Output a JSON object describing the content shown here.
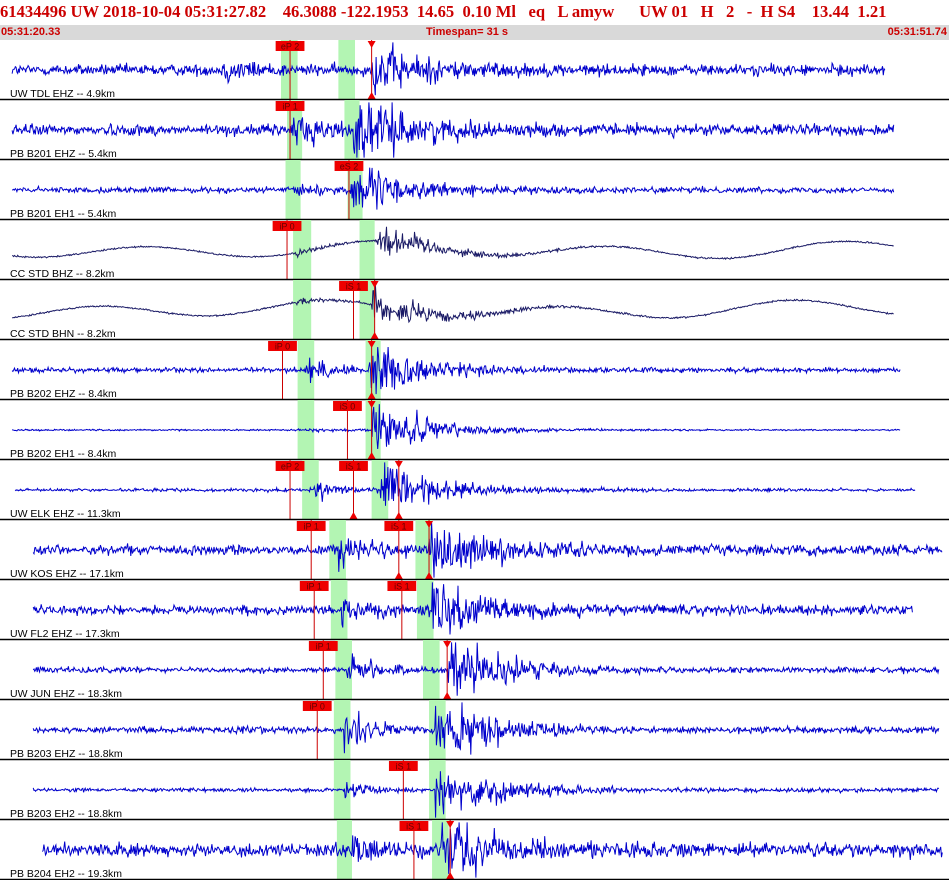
{
  "header": {
    "event_id": "61434496",
    "network": "UW",
    "origin_time": "2018-10-04 05:31:27.82",
    "lat": "46.3088",
    "lon": "-122.1953",
    "depth": "14.65",
    "depth_err": "0.10",
    "mag_type": "Ml",
    "event_type": "eq",
    "location_type": "L",
    "analyst": "amyw",
    "source": "UW",
    "version": "01",
    "flag1": "H",
    "flag2": "2",
    "flag3": "-",
    "flag4": "H",
    "flag5": "S4",
    "rms_value": "13.44",
    "magnitude": "1.21"
  },
  "timebar": {
    "start": "05:31:20.33",
    "span": "Timespan=  31 s",
    "end": "05:31:51.74"
  },
  "colors": {
    "header_text": "#cc0000",
    "timebar_bg": "#d9d9d9",
    "trace_short_period": "#0000cc",
    "trace_broadband": "#1a1a66",
    "pick_flag": "#ee0000",
    "pick_line": "#cc0000",
    "window_highlight": "#b3f5b3",
    "separator": "#000000",
    "label_text": "#000000"
  },
  "chart_data": {
    "type": "line",
    "title": "",
    "x_unit": "s",
    "xlim": [
      0,
      31.41
    ],
    "traces": [
      {
        "label": "UW TDL EHZ -- 4.9km",
        "network": "UW",
        "station": "TDL",
        "channel": "EHZ",
        "distance_km": 4.9,
        "kind": "sp",
        "data_start": 0.4,
        "data_end": 29.3,
        "p_onset": 7.4,
        "s_onset": 12.3,
        "noise": 0.14,
        "p_amp": 0.25,
        "s_amp": 0.6,
        "picks": [
          {
            "label": "eP 2",
            "time": 9.6,
            "marker": false
          },
          {
            "label": "",
            "time": 12.3,
            "marker": true
          }
        ],
        "windows": [
          {
            "start": 9.3,
            "end": 9.85
          },
          {
            "start": 11.2,
            "end": 11.75
          }
        ]
      },
      {
        "label": "PB B201 EHZ -- 5.4km",
        "network": "PB",
        "station": "B201",
        "channel": "EHZ",
        "distance_km": 5.4,
        "kind": "sp",
        "data_start": 0.4,
        "data_end": 29.6,
        "p_onset": 9.7,
        "s_onset": 11.7,
        "noise": 0.14,
        "p_amp": 0.5,
        "s_amp": 0.75,
        "picks": [
          {
            "label": "iP 1",
            "time": 9.6,
            "marker": false
          }
        ],
        "windows": [
          {
            "start": 9.5,
            "end": 10.0
          },
          {
            "start": 11.4,
            "end": 11.9
          }
        ]
      },
      {
        "label": "PB B201 EH1 -- 5.4km",
        "network": "PB",
        "station": "B201",
        "channel": "EH1",
        "distance_km": 5.4,
        "kind": "sp",
        "data_start": 0.4,
        "data_end": 29.6,
        "p_onset": 9.8,
        "s_onset": 11.6,
        "noise": 0.07,
        "p_amp": 0.2,
        "s_amp": 0.6,
        "picks": [
          {
            "label": "eS 2",
            "time": 11.55,
            "marker": false
          }
        ],
        "windows": [
          {
            "start": 9.45,
            "end": 9.95
          },
          {
            "start": 11.5,
            "end": 12.0
          }
        ]
      },
      {
        "label": "CC STD BHZ -- 8.2km",
        "network": "CC",
        "station": "STD",
        "channel": "BHZ",
        "distance_km": 8.2,
        "kind": "bb",
        "data_start": 0.4,
        "data_end": 29.6,
        "p_onset": 9.7,
        "s_onset": 12.5,
        "noise": 0.02,
        "p_amp": 0.1,
        "s_amp": 0.45,
        "swell": 0.33,
        "picks": [
          {
            "label": "iP 0",
            "time": 9.5,
            "marker": false
          }
        ],
        "windows": [
          {
            "start": 9.7,
            "end": 10.3
          },
          {
            "start": 11.9,
            "end": 12.4
          }
        ]
      },
      {
        "label": "CC STD BHN -- 8.2km",
        "network": "CC",
        "station": "STD",
        "channel": "BHN",
        "distance_km": 8.2,
        "kind": "bb",
        "data_start": 0.4,
        "data_end": 29.6,
        "p_onset": 9.8,
        "s_onset": 12.3,
        "noise": 0.02,
        "p_amp": 0.08,
        "s_amp": 0.55,
        "swell": 0.35,
        "picks": [
          {
            "label": "iS 1",
            "time": 11.7,
            "marker": false
          },
          {
            "label": "",
            "time": 12.4,
            "marker": true
          }
        ],
        "windows": [
          {
            "start": 9.7,
            "end": 10.3
          },
          {
            "start": 11.9,
            "end": 12.4
          }
        ]
      },
      {
        "label": "PB B202 EHZ -- 8.4km",
        "network": "PB",
        "station": "B202",
        "channel": "EHZ",
        "distance_km": 8.4,
        "kind": "sp",
        "data_start": 0.4,
        "data_end": 29.8,
        "p_onset": 10.1,
        "s_onset": 12.2,
        "noise": 0.06,
        "p_amp": 0.3,
        "s_amp": 0.7,
        "picks": [
          {
            "label": "iP 0",
            "time": 9.35,
            "marker": false
          },
          {
            "label": "",
            "time": 12.3,
            "marker": true
          }
        ],
        "windows": [
          {
            "start": 9.85,
            "end": 10.4
          },
          {
            "start": 12.1,
            "end": 12.6
          }
        ]
      },
      {
        "label": "PB B202 EH1 -- 8.4km",
        "network": "PB",
        "station": "B202",
        "channel": "EH1",
        "distance_km": 8.4,
        "kind": "sp",
        "data_start": 0.4,
        "data_end": 29.8,
        "p_onset": 10.1,
        "s_onset": 12.3,
        "noise": 0.02,
        "p_amp": 0.05,
        "s_amp": 0.75,
        "picks": [
          {
            "label": "iS 0",
            "time": 11.5,
            "marker": false
          },
          {
            "label": "",
            "time": 12.3,
            "marker": true
          }
        ],
        "windows": [
          {
            "start": 9.85,
            "end": 10.4
          },
          {
            "start": 12.1,
            "end": 12.6
          }
        ]
      },
      {
        "label": "UW ELK EHZ -- 11.3km",
        "network": "UW",
        "station": "ELK",
        "channel": "EHZ",
        "distance_km": 11.3,
        "kind": "sp",
        "data_start": 0.5,
        "data_end": 30.3,
        "p_onset": 10.4,
        "s_onset": 12.6,
        "noise": 0.04,
        "p_amp": 0.22,
        "s_amp": 0.75,
        "picks": [
          {
            "label": "eP 2",
            "time": 9.6,
            "marker": false
          },
          {
            "label": "iS 1",
            "time": 11.7,
            "marker": true
          },
          {
            "label": "",
            "time": 13.2,
            "marker": true
          }
        ],
        "windows": [
          {
            "start": 10.0,
            "end": 10.55
          },
          {
            "start": 12.3,
            "end": 12.85
          }
        ]
      },
      {
        "label": "UW KOS EHZ -- 17.1km",
        "network": "UW",
        "station": "KOS",
        "channel": "EHZ",
        "distance_km": 17.1,
        "kind": "sp",
        "data_start": 1.1,
        "data_end": 31.2,
        "p_onset": 11.2,
        "s_onset": 14.2,
        "noise": 0.12,
        "p_amp": 0.45,
        "s_amp": 0.7,
        "picks": [
          {
            "label": "iP 1",
            "time": 10.3,
            "marker": false
          },
          {
            "label": "iS 1",
            "time": 13.2,
            "marker": true
          },
          {
            "label": "",
            "time": 14.2,
            "marker": true
          }
        ],
        "windows": [
          {
            "start": 10.9,
            "end": 11.45
          },
          {
            "start": 13.75,
            "end": 14.3
          }
        ]
      },
      {
        "label": "UW FL2 EHZ -- 17.3km",
        "network": "UW",
        "station": "FL2",
        "channel": "EHZ",
        "distance_km": 17.3,
        "kind": "sp",
        "data_start": 1.1,
        "data_end": 30.2,
        "p_onset": 11.3,
        "s_onset": 14.3,
        "noise": 0.12,
        "p_amp": 0.3,
        "s_amp": 0.7,
        "picks": [
          {
            "label": "iP 1",
            "time": 10.4,
            "marker": false
          },
          {
            "label": "iS 1",
            "time": 13.3,
            "marker": false
          }
        ],
        "windows": [
          {
            "start": 10.95,
            "end": 11.5
          },
          {
            "start": 13.8,
            "end": 14.35
          }
        ]
      },
      {
        "label": "UW JUN EHZ -- 18.3km",
        "network": "UW",
        "station": "JUN",
        "channel": "EHZ",
        "distance_km": 18.3,
        "kind": "sp",
        "data_start": 1.1,
        "data_end": 31.1,
        "p_onset": 11.5,
        "s_onset": 14.8,
        "noise": 0.07,
        "p_amp": 0.35,
        "s_amp": 0.85,
        "picks": [
          {
            "label": "iP 1",
            "time": 10.7,
            "marker": false
          },
          {
            "label": "",
            "time": 14.8,
            "marker": true
          }
        ],
        "windows": [
          {
            "start": 11.1,
            "end": 11.65
          },
          {
            "start": 14.0,
            "end": 14.55
          }
        ]
      },
      {
        "label": "PB B203 EHZ -- 18.8km",
        "network": "PB",
        "station": "B203",
        "channel": "EHZ",
        "distance_km": 18.8,
        "kind": "sp",
        "data_start": 1.1,
        "data_end": 31.1,
        "p_onset": 11.4,
        "s_onset": 14.4,
        "noise": 0.08,
        "p_amp": 0.45,
        "s_amp": 0.8,
        "picks": [
          {
            "label": "iP 0",
            "time": 10.5,
            "marker": false
          }
        ],
        "windows": [
          {
            "start": 11.05,
            "end": 11.6
          },
          {
            "start": 14.2,
            "end": 14.75
          }
        ]
      },
      {
        "label": "PB B203 EH2 -- 18.8km",
        "network": "PB",
        "station": "B203",
        "channel": "EH2",
        "distance_km": 18.8,
        "kind": "sp",
        "data_start": 1.1,
        "data_end": 31.1,
        "p_onset": 11.4,
        "s_onset": 14.4,
        "noise": 0.05,
        "p_amp": 0.2,
        "s_amp": 0.8,
        "picks": [
          {
            "label": "iS 1",
            "time": 13.35,
            "marker": false
          }
        ],
        "windows": [
          {
            "start": 11.05,
            "end": 11.6
          },
          {
            "start": 14.2,
            "end": 14.75
          }
        ]
      },
      {
        "label": "PB B204 EH2 -- 19.3km",
        "network": "PB",
        "station": "B204",
        "channel": "EH2",
        "distance_km": 19.3,
        "kind": "sp",
        "data_start": 1.4,
        "data_end": 31.2,
        "p_onset": 11.6,
        "s_onset": 14.6,
        "noise": 0.16,
        "p_amp": 0.35,
        "s_amp": 0.7,
        "picks": [
          {
            "label": "iS 1",
            "time": 13.7,
            "marker": false
          },
          {
            "label": "",
            "time": 14.9,
            "marker": true
          }
        ],
        "windows": [
          {
            "start": 11.15,
            "end": 11.65
          },
          {
            "start": 14.3,
            "end": 14.85
          }
        ]
      }
    ]
  }
}
